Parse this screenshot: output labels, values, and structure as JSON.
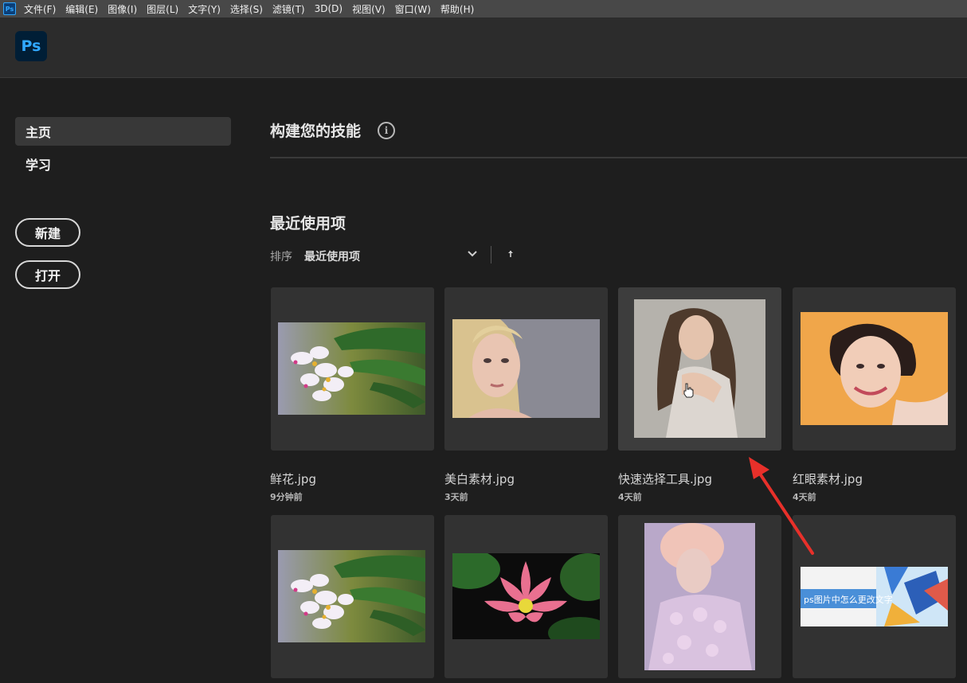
{
  "menubar": {
    "app_icon": "Ps",
    "items": [
      "文件(F)",
      "编辑(E)",
      "图像(I)",
      "图层(L)",
      "文字(Y)",
      "选择(S)",
      "滤镜(T)",
      "3D(D)",
      "视图(V)",
      "窗口(W)",
      "帮助(H)"
    ]
  },
  "header": {
    "logo": "Ps"
  },
  "sidebar": {
    "nav": [
      {
        "label": "主页",
        "active": true
      },
      {
        "label": "学习",
        "active": false
      }
    ],
    "new_button": "新建",
    "open_button": "打开"
  },
  "main": {
    "skills_title": "构建您的技能",
    "info_icon": "i",
    "recent_title": "最近使用项",
    "sort_label": "排序",
    "sort_value": "最近使用项",
    "files": [
      {
        "name": "鲜花.jpg",
        "time": "9分钟前",
        "thumb": "flower"
      },
      {
        "name": "美白素材.jpg",
        "time": "3天前",
        "thumb": "blonde"
      },
      {
        "name": "快速选择工具.jpg",
        "time": "4天前",
        "thumb": "brunette"
      },
      {
        "name": "红眼素材.jpg",
        "time": "4天前",
        "thumb": "smile"
      }
    ],
    "row2": [
      {
        "thumb": "flower"
      },
      {
        "thumb": "lotus"
      },
      {
        "thumb": "pastel"
      },
      {
        "thumb": "banner",
        "caption": "ps图片中怎么更改文字"
      }
    ]
  },
  "colors": {
    "accent": "#31a8ff",
    "arrow": "#e8302a",
    "background": "#1e1e1e"
  }
}
